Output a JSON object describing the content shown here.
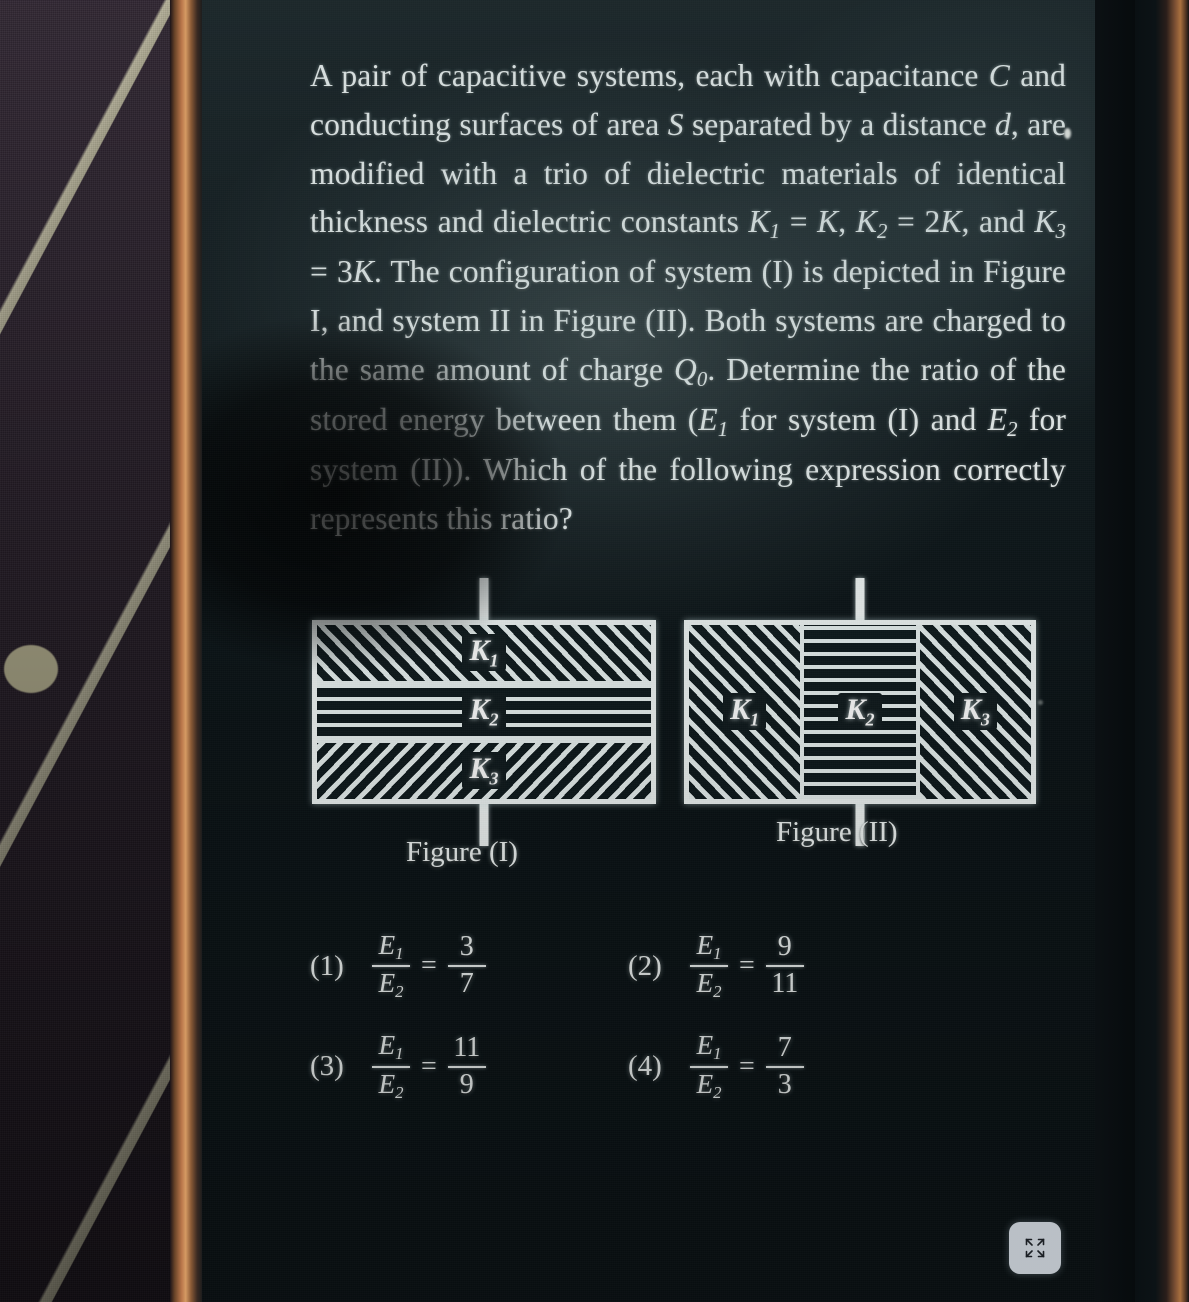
{
  "question": {
    "segments": [
      {
        "t": "A pair of capacitive systems, each with capacitance "
      },
      {
        "t": "C",
        "i": true
      },
      {
        "t": " and conducting surfaces of area "
      },
      {
        "t": "S",
        "i": true
      },
      {
        "t": " separated by a distance "
      },
      {
        "t": "d",
        "i": true
      },
      {
        "t": ", are modified with a trio of dielectric materials of identical thickness and dielectric constants "
      },
      {
        "t": "K",
        "i": true,
        "sub": "1"
      },
      {
        "t": " = "
      },
      {
        "t": "K",
        "i": true
      },
      {
        "t": ", "
      },
      {
        "t": "K",
        "i": true,
        "sub": "2"
      },
      {
        "t": " = 2"
      },
      {
        "t": "K",
        "i": true
      },
      {
        "t": ", and "
      },
      {
        "t": "K",
        "i": true,
        "sub": "3"
      },
      {
        "t": " = 3"
      },
      {
        "t": "K",
        "i": true
      },
      {
        "t": ". The configuration of system (I) is depicted in Figure I, and system II in Figure (II). Both systems are charged to the same amount of charge "
      },
      {
        "t": "Q",
        "i": true,
        "sub": "0"
      },
      {
        "t": ". Determine the ratio of the stored energy between them ("
      },
      {
        "t": "E",
        "i": true,
        "sub": "1"
      },
      {
        "t": " for system (I) and "
      },
      {
        "t": "E",
        "i": true,
        "sub": "2"
      },
      {
        "t": " for system (II)). Which of the following expression correctly represents this ratio?"
      }
    ],
    "plain": "A pair of capacitive systems, each with capacitance C and conducting surfaces of area S separated by a distance d, are modified with a trio of dielectric materials of identical thickness and dielectric constants K1 = K, K2 = 2K, and K3 = 3K. The configuration of system (I) is depicted in Figure I, and system II in Figure (II). Both systems are charged to the same amount of charge Q0. Determine the ratio of the stored energy between them (E1 for system (I) and E2 for system (II)). Which of the following expression correctly represents this ratio?"
  },
  "figures": [
    {
      "id": "figure-1",
      "caption": "Figure (I)",
      "arrangement": "series-horizontal-layers",
      "layers": [
        {
          "label": "K",
          "sub": "1",
          "hatch": "diagonal-up"
        },
        {
          "label": "K",
          "sub": "2",
          "hatch": "horizontal"
        },
        {
          "label": "K",
          "sub": "3",
          "hatch": "diagonal-down"
        }
      ]
    },
    {
      "id": "figure-2",
      "caption": "Figure (II)",
      "arrangement": "parallel-vertical-columns",
      "layers": [
        {
          "label": "K",
          "sub": "1",
          "hatch": "diagonal-up"
        },
        {
          "label": "K",
          "sub": "2",
          "hatch": "horizontal"
        },
        {
          "label": "K",
          "sub": "3",
          "hatch": "diagonal-up"
        }
      ]
    }
  ],
  "options": [
    {
      "num": "(1)",
      "lhs_num": "E",
      "lhs_num_sub": "1",
      "lhs_den": "E",
      "lhs_den_sub": "2",
      "eq": "=",
      "rhs_num": "3",
      "rhs_den": "7"
    },
    {
      "num": "(2)",
      "lhs_num": "E",
      "lhs_num_sub": "1",
      "lhs_den": "E",
      "lhs_den_sub": "2",
      "eq": "=",
      "rhs_num": "9",
      "rhs_den": "11"
    },
    {
      "num": "(3)",
      "lhs_num": "E",
      "lhs_num_sub": "1",
      "lhs_den": "E",
      "lhs_den_sub": "2",
      "eq": "=",
      "rhs_num": "11",
      "rhs_den": "9"
    },
    {
      "num": "(4)",
      "lhs_num": "E",
      "lhs_num_sub": "1",
      "lhs_den": "E",
      "lhs_den_sub": "2",
      "eq": "=",
      "rhs_num": "7",
      "rhs_den": "3"
    }
  ],
  "controls": {
    "fullscreen_icon": "fullscreen-expand-icon"
  },
  "colors": {
    "screen_background": "#0c1417",
    "text": "#f2f7f6",
    "diagram_stroke": "#eaf2f1",
    "bezel": "#b9764a",
    "fabric": "#2f2431",
    "fabric_stripe": "#cfcaa6",
    "button_background": "#c9cfd6"
  }
}
